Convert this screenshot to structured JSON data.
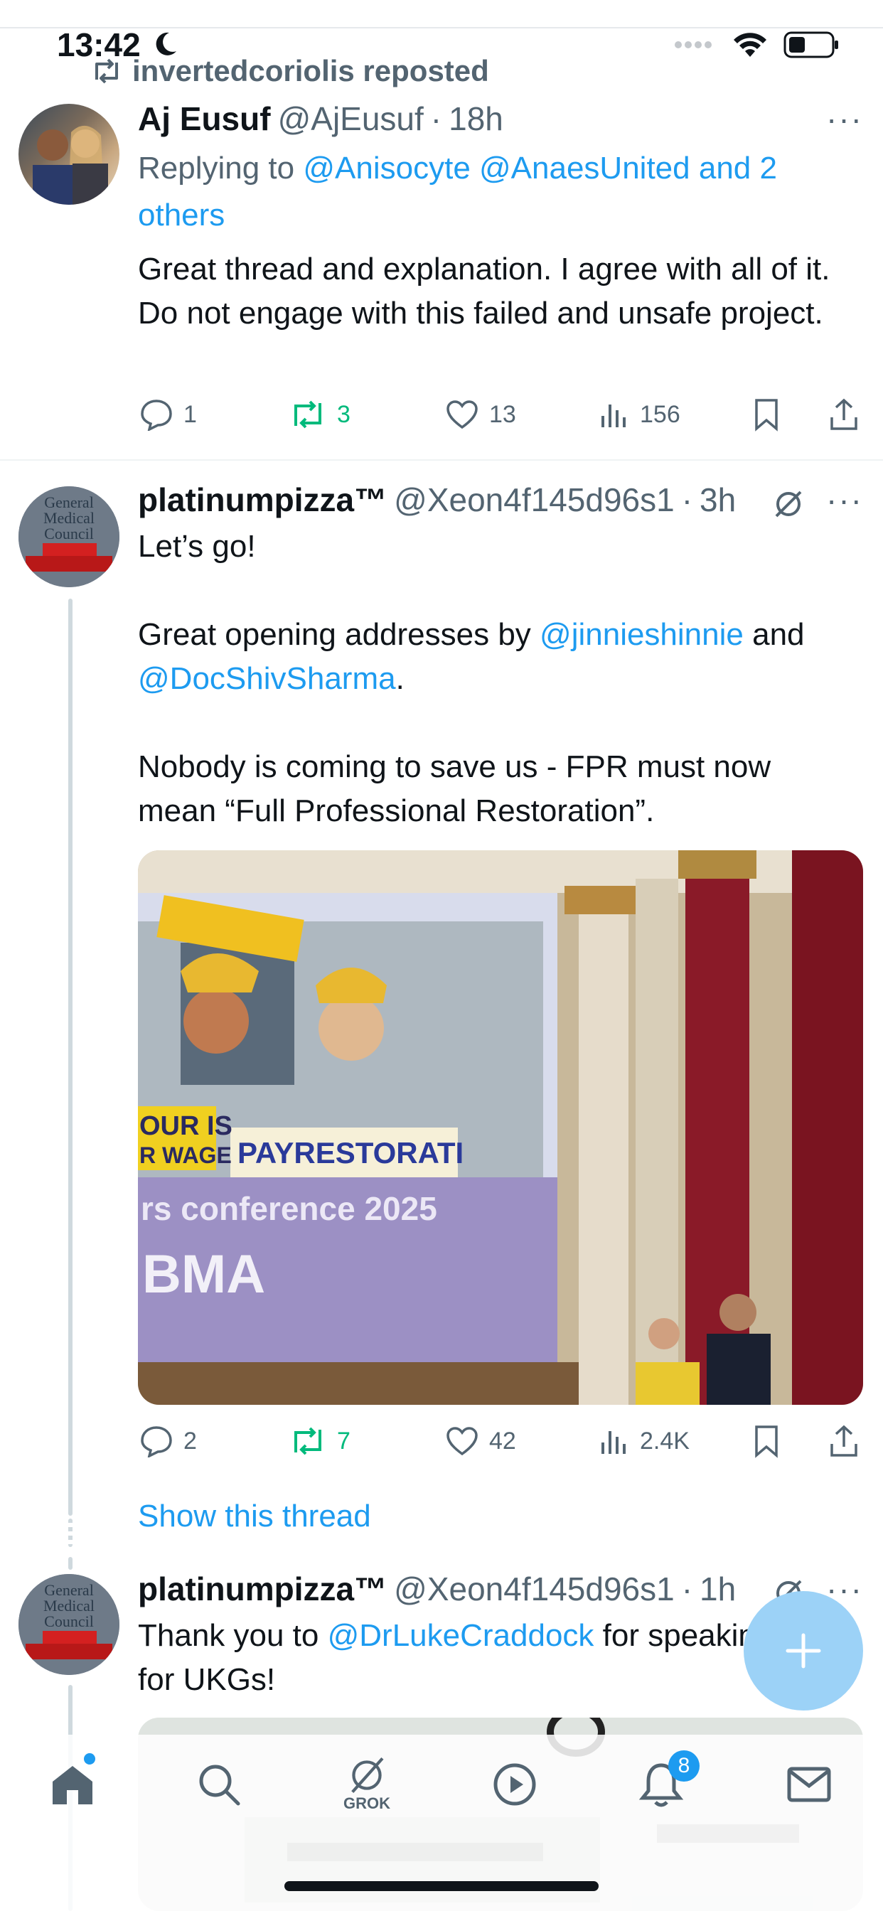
{
  "status_bar": {
    "time": "13:42"
  },
  "tweets": [
    {
      "repost_label": "invertedcoriolis reposted",
      "author_name": "Aj Eusuf",
      "author_handle": "@AjEusuf",
      "time": "18h",
      "reply_prefix": "Replying to ",
      "reply_mentions": "@Anisocyte @AnaesUnited and 2 others",
      "text": "Great thread and explanation. I agree with all of it. Do not engage with this failed and unsafe project.",
      "replies": "1",
      "reposts": "3",
      "likes": "13",
      "views": "156"
    },
    {
      "author_name": "platinumpizza™",
      "author_handle": "@Xeon4f145d96s1",
      "time": "3h",
      "line1": "Let’s go!",
      "line2_pre": "Great opening addresses by ",
      "mention1": "@jinnieshinnie",
      "line2_mid": " and",
      "mention2": "@DocShivSharma",
      "line2_post": ".",
      "line3": "Nobody is coming to save us - FPR must now mean “Full Professional Restoration”.",
      "image_text_conference": "rs conference 2025",
      "image_text_bma": "BMA",
      "image_text_sign": "PAYRESTORATI",
      "image_text_sign2": "OUR IS",
      "image_text_sign3": "R WAGE",
      "replies": "2",
      "reposts": "7",
      "likes": "42",
      "views": "2.4K",
      "show_thread": "Show this thread"
    },
    {
      "author_name": "platinumpizza™",
      "author_handle": "@Xeon4f145d96s1",
      "time": "1h",
      "text_pre": "Thank you to ",
      "mention": "@DrLukeCraddock",
      "text_post": " for speaking up for UKGs!"
    }
  ],
  "nav": {
    "grok_label": "GROK",
    "notifications_badge": "8"
  },
  "colors": {
    "link": "#1d9bf0",
    "repost_green": "#00ba7c",
    "muted": "#536471",
    "fab": "#9cd2f7"
  }
}
